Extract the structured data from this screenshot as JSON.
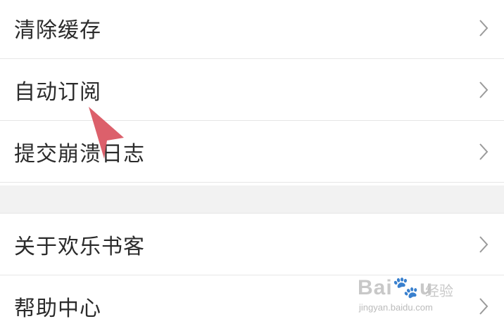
{
  "settings": {
    "group1": [
      {
        "label": "清除缓存",
        "icon": "chevron-right-icon"
      },
      {
        "label": "自动订阅",
        "icon": "chevron-right-icon"
      },
      {
        "label": "提交崩溃日志",
        "icon": "chevron-right-icon"
      }
    ],
    "group2": [
      {
        "label": "关于欢乐书客",
        "icon": "chevron-right-icon"
      },
      {
        "label": "帮助中心",
        "icon": "chevron-right-icon"
      }
    ]
  },
  "overlay": {
    "pointer_color": "#d9525e"
  },
  "watermark": {
    "logo": "Bai🐾u",
    "cn": "经验",
    "url": "jingyan.baidu.com"
  }
}
